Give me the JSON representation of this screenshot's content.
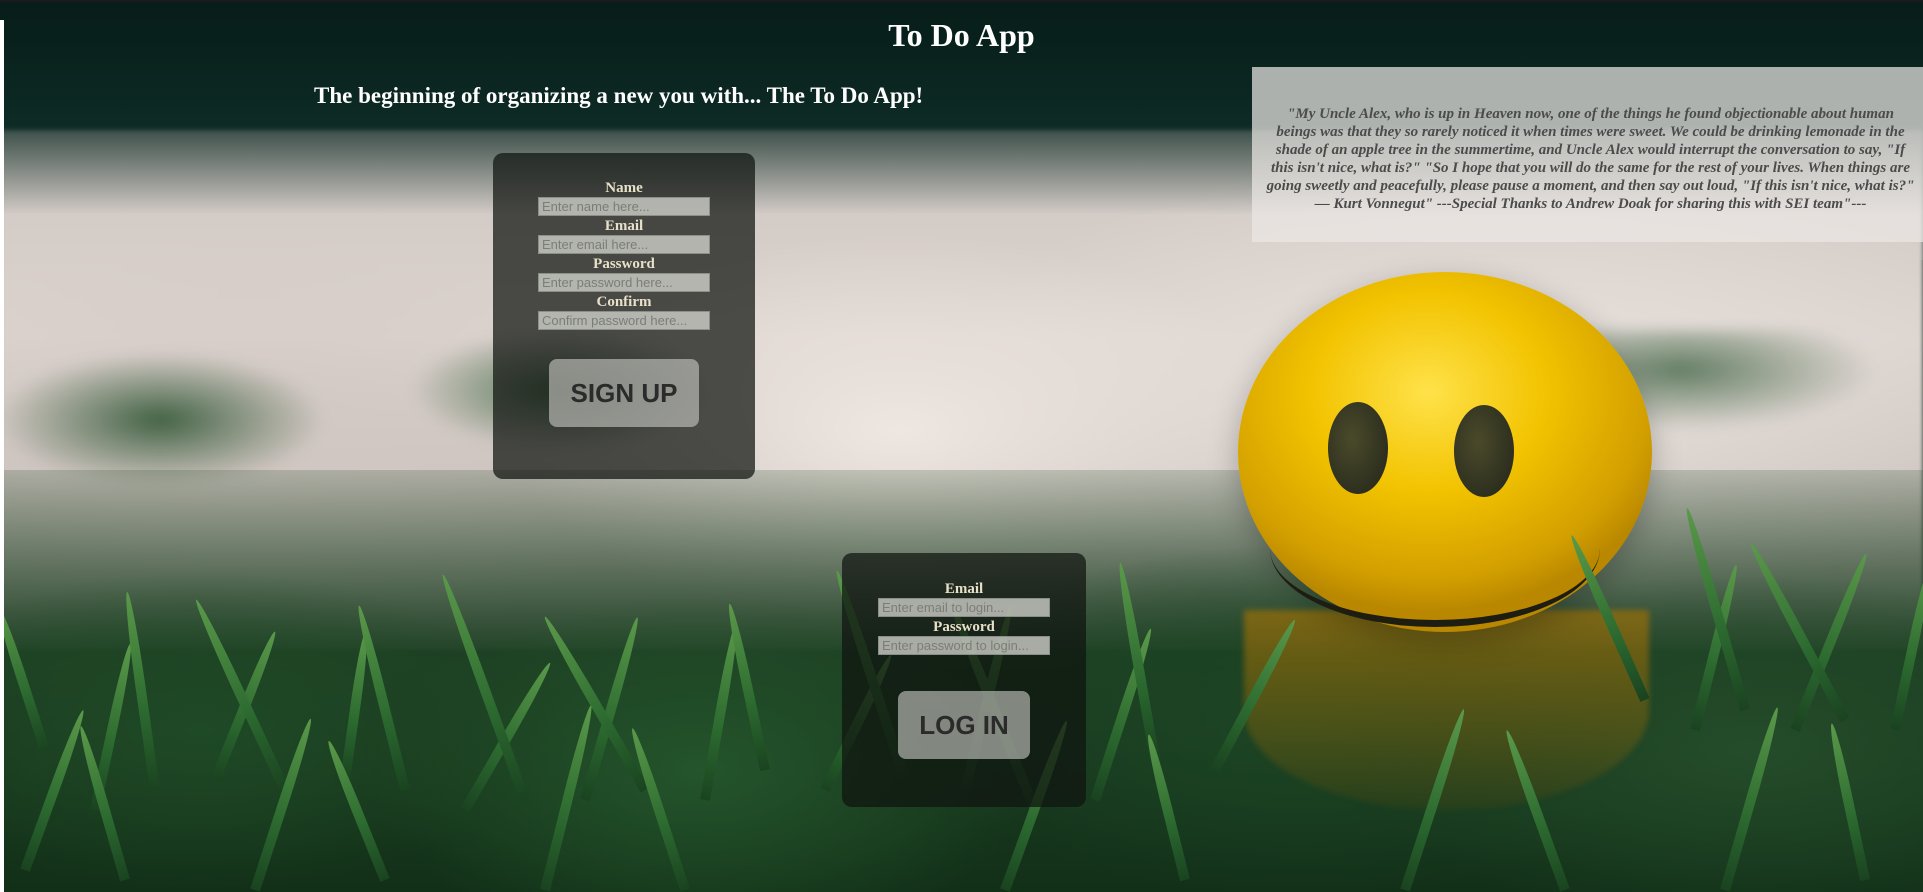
{
  "header": {
    "title": "To Do App",
    "tagline": "The beginning of organizing a new you with... The To Do App!"
  },
  "quote": {
    "text": "\"My Uncle Alex, who is up in Heaven now, one of the things he found objectionable about human beings was that they so rarely noticed it when times were sweet. We could be drinking lemonade in the shade of an apple tree in the summertime, and Uncle Alex would interrupt the conversation to say, \"If this isn't nice, what is?\" \"So I hope that you will do the same for the rest of your lives. When things are going sweetly and peacefully, please pause a moment, and then say out loud, \"If this isn't nice, what is?\" ― Kurt Vonnegut\" ---Special Thanks to Andrew Doak for sharing this with SEI team\"---"
  },
  "signup_form": {
    "name_label": "Name",
    "name_placeholder": "Enter name here...",
    "email_label": "Email",
    "email_placeholder": "Enter email here...",
    "password_label": "Password",
    "password_placeholder": "Enter password here...",
    "confirm_label": "Confirm",
    "confirm_placeholder": "Confirm password here...",
    "submit_label": "SIGN UP"
  },
  "login_form": {
    "email_label": "Email",
    "email_placeholder": "Enter email to login...",
    "password_label": "Password",
    "password_placeholder": "Enter password to login...",
    "submit_label": "LOG IN"
  },
  "colors": {
    "heading_text": "#ffffff",
    "form_label": "#e8e0c8",
    "ball_yellow": "#f2c300",
    "grass_green": "#2c6a30"
  }
}
